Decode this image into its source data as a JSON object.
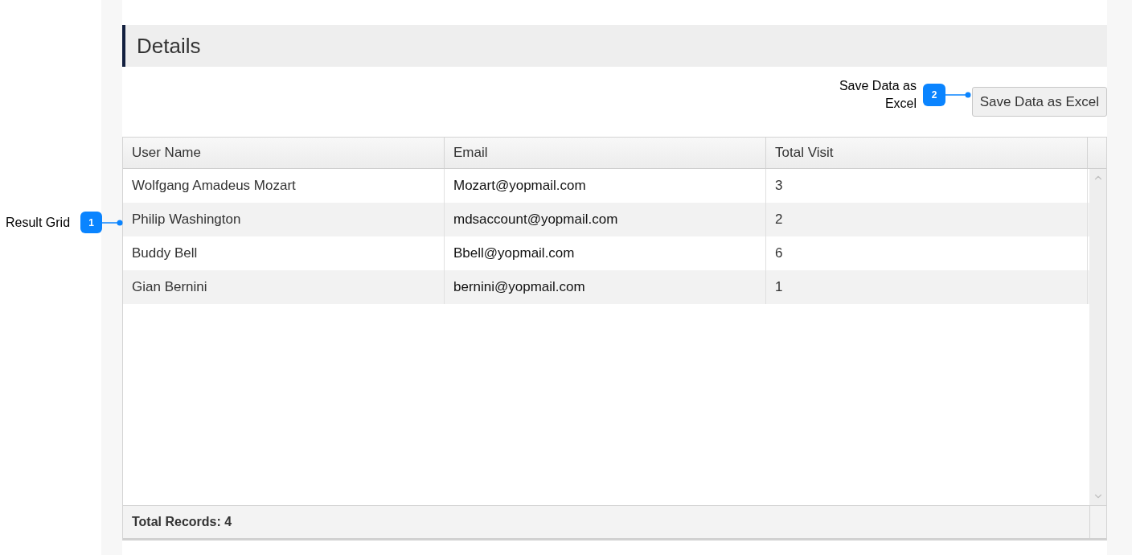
{
  "section": {
    "title": "Details"
  },
  "toolbar": {
    "button": "Save Data as Excel"
  },
  "table": {
    "columns": [
      "User Name",
      "Email",
      "Total Visit"
    ],
    "rows": [
      [
        "Wolfgang Amadeus Mozart",
        "Mozart@yopmail.com",
        "3"
      ],
      [
        "Philip Washington",
        "mdsaccount@yopmail.com",
        "2"
      ],
      [
        "Buddy Bell",
        "Bbell@yopmail.com",
        "6"
      ],
      [
        "Gian Bernini",
        "bernini@yopmail.com",
        "1"
      ]
    ],
    "footer": "Total Records: 4"
  },
  "callouts": [
    {
      "number": "1",
      "label": "Result Grid"
    },
    {
      "number": "2",
      "label": "Save Data as Excel"
    }
  ]
}
